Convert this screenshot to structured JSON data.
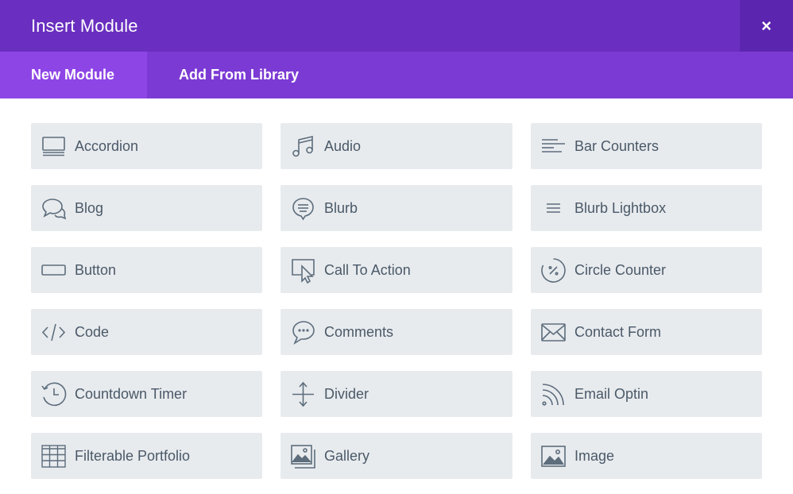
{
  "dialog": {
    "title": "Insert Module",
    "close_label": "×"
  },
  "tabs": [
    {
      "label": "New Module",
      "active": true
    },
    {
      "label": "Add From Library",
      "active": false
    }
  ],
  "modules": [
    {
      "label": "Accordion",
      "icon": "accordion-icon"
    },
    {
      "label": "Audio",
      "icon": "music-note-icon"
    },
    {
      "label": "Bar Counters",
      "icon": "bar-counters-icon"
    },
    {
      "label": "Blog",
      "icon": "chat-bubbles-icon"
    },
    {
      "label": "Blurb",
      "icon": "blurb-bubble-icon"
    },
    {
      "label": "Blurb Lightbox",
      "icon": "lines-icon"
    },
    {
      "label": "Button",
      "icon": "button-rect-icon"
    },
    {
      "label": "Call To Action",
      "icon": "cursor-icon"
    },
    {
      "label": "Circle Counter",
      "icon": "circle-percent-icon"
    },
    {
      "label": "Code",
      "icon": "code-icon"
    },
    {
      "label": "Comments",
      "icon": "comment-dots-icon"
    },
    {
      "label": "Contact Form",
      "icon": "envelope-icon"
    },
    {
      "label": "Countdown Timer",
      "icon": "history-clock-icon"
    },
    {
      "label": "Divider",
      "icon": "divider-arrows-icon"
    },
    {
      "label": "Email Optin",
      "icon": "rss-icon"
    },
    {
      "label": "Filterable Portfolio",
      "icon": "grid-table-icon"
    },
    {
      "label": "Gallery",
      "icon": "gallery-icon"
    },
    {
      "label": "Image",
      "icon": "image-icon"
    }
  ],
  "colors": {
    "titlebar": "#6a2ec0",
    "tabbar": "#7c3ad4",
    "active_tab": "#8e45e6",
    "card_bg": "#e8ebee",
    "card_text": "#4a5968"
  }
}
